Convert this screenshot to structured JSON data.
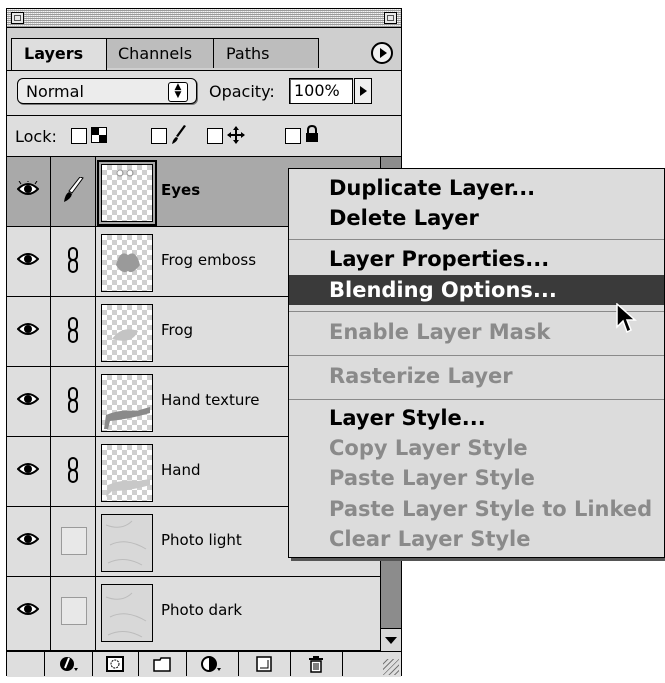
{
  "panel": {
    "tabs": [
      "Layers",
      "Channels",
      "Paths"
    ],
    "active_tab": "Layers",
    "blend_mode": "Normal",
    "opacity_label": "Opacity:",
    "opacity_value": "100%",
    "lock_label": "Lock:"
  },
  "layers": [
    {
      "name": "Eyes",
      "selected": true,
      "link": "brush-icon"
    },
    {
      "name": "Frog emboss",
      "link": "chain-icon"
    },
    {
      "name": "Frog",
      "link": "chain-icon"
    },
    {
      "name": "Hand texture",
      "link": "chain-icon"
    },
    {
      "name": "Hand",
      "link": "chain-icon"
    },
    {
      "name": "Photo light",
      "link": "none"
    },
    {
      "name": "Photo dark",
      "link": "none"
    }
  ],
  "context_menu": {
    "items": [
      {
        "label": "Duplicate Layer...",
        "enabled": true
      },
      {
        "label": "Delete Layer",
        "enabled": true
      },
      {
        "label": "Layer Properties...",
        "enabled": true
      },
      {
        "label": "Blending Options...",
        "enabled": true,
        "highlighted": true
      },
      {
        "label": "Enable Layer Mask",
        "enabled": false
      },
      {
        "label": "Rasterize Layer",
        "enabled": false
      },
      {
        "label": "Layer Style...",
        "enabled": true
      },
      {
        "label": "Copy Layer Style",
        "enabled": false
      },
      {
        "label": "Paste Layer Style",
        "enabled": false
      },
      {
        "label": "Paste Layer Style to Linked",
        "enabled": false
      },
      {
        "label": "Clear Layer Style",
        "enabled": false
      }
    ]
  },
  "colors": {
    "highlight": "#3a3a3a",
    "disabled_text": "#8a8a8a",
    "panel_bg": "#dedede"
  }
}
